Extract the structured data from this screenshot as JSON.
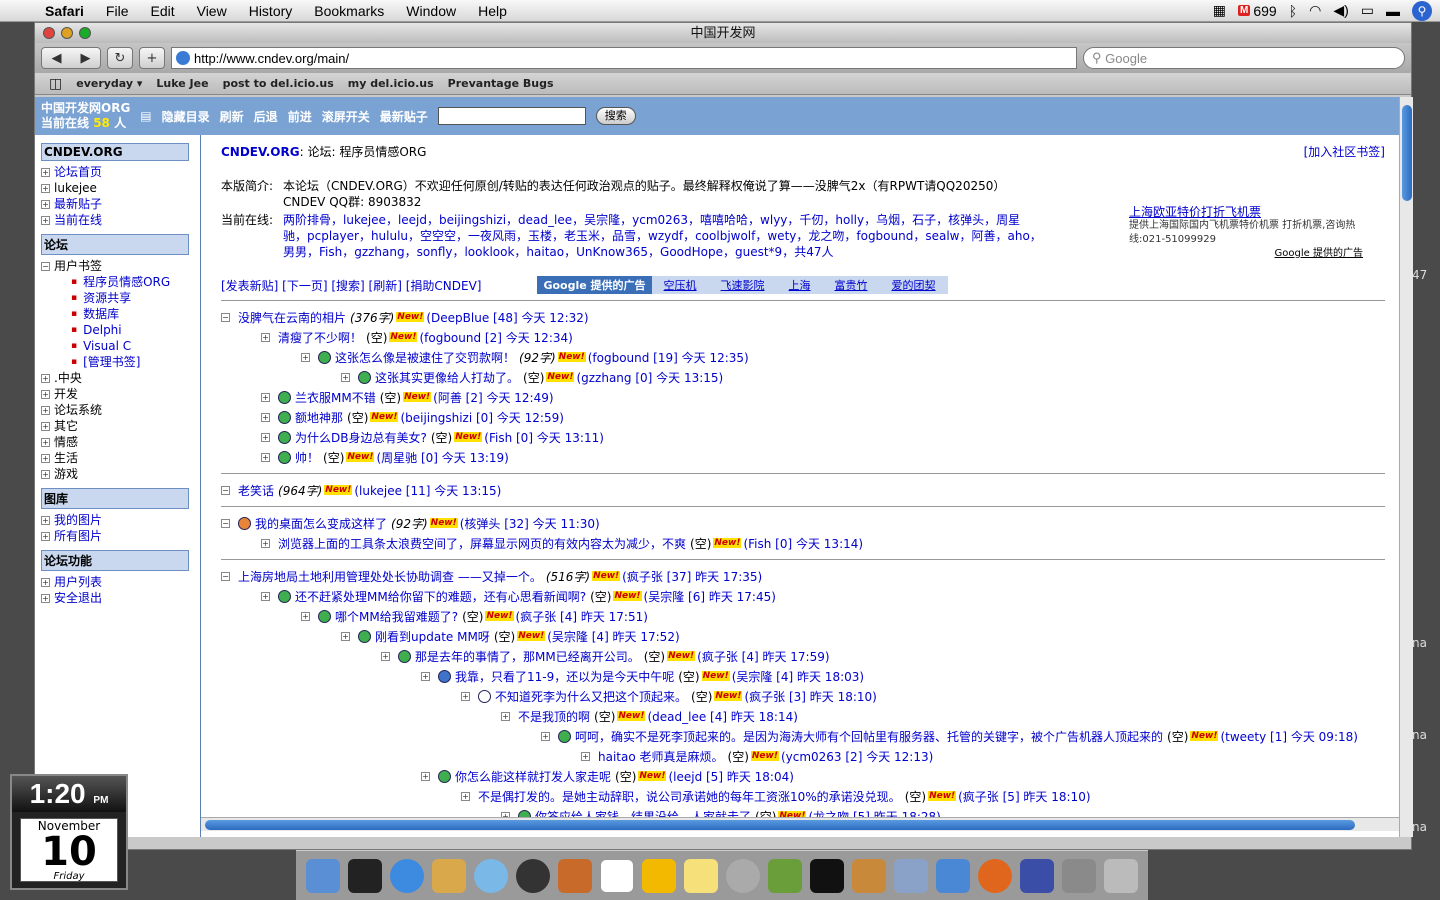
{
  "menubar": {
    "app": "Safari",
    "items": [
      "File",
      "Edit",
      "View",
      "History",
      "Bookmarks",
      "Window",
      "Help"
    ],
    "mail_count": "699"
  },
  "window": {
    "title": "中国开发网"
  },
  "toolbar": {
    "url": "http://www.cndev.org/main/",
    "search_placeholder": "Google"
  },
  "bookmarks": [
    "everyday ▾",
    "Luke Jee",
    "post to del.icio.us",
    "my del.icio.us",
    "Prevantage Bugs"
  ],
  "topbar": {
    "site": "中国开发网ORG",
    "online_prefix": "当前在线",
    "online_count": "58",
    "online_suffix": "人",
    "links": [
      "隐藏目录",
      "刷新",
      "后退",
      "前进",
      "滚屏开关",
      "最新贴子"
    ],
    "search_button": "搜索"
  },
  "sidebar": {
    "title": "CNDEV.ORG",
    "group1": [
      "论坛首页",
      "lukejee",
      "最新贴子",
      "当前在线"
    ],
    "section_forum": "论坛",
    "bookmarks_label": "用户书签",
    "bookmark_items": [
      "程序员情感ORG",
      "资源共享",
      "数据库",
      "Delphi",
      "Visual C",
      "[管理书签]"
    ],
    "forum_items": [
      ".中央",
      "开发",
      "论坛系统",
      "其它",
      "情感",
      "生活",
      "游戏"
    ],
    "section_photos": "图库",
    "photo_items": [
      "我的图片",
      "所有图片"
    ],
    "section_functions": "论坛功能",
    "function_items": [
      "用户列表",
      "安全退出"
    ]
  },
  "main": {
    "brand": "CNDEV.ORG",
    "crumb": ": 论坛: 程序员情感ORG",
    "join_link": "[加入社区书签]",
    "intro_label": "本版简介:",
    "intro_text": "本论坛（CNDEV.ORG）不欢迎任何原创/转贴的表达任何政治观点的贴子。最终解释权俺说了算——没脾气2x（有RPWT请QQ20250）",
    "qq_group": "CNDEV QQ群: 8903832",
    "online_label": "当前在线:",
    "online_users": "两阶排骨，lukejee，leejd，beijingshizi，dead_lee，吴宗隆，ycm0263，嘻嘻哈哈，wlyy，千仞，holly，乌烟，石子，核弹头，周星驰，pcplayer，hululu，空空空，一夜风雨，玉楼，老玉米，品雪，wzydf，coolbjwolf，wety，龙之吻，fogbound，sealw，阿善，aho，男男，Fish，gzzhang，sonfly，looklook，haitao，UnKnow365，GoodHope，guest*9，共47人",
    "actions": "[发表新贴] [下一页] [搜索] [刷新] [捐助CNDEV]",
    "google_ads_label": "Google 提供的广告",
    "google_ads": [
      "空压机",
      "飞速影院",
      "上海",
      "富贵竹",
      "爱的团契"
    ],
    "ad_title": "上海欧亚特价打折飞机票",
    "ad_body": "提供上海国际国内飞机票特价机票 打折机票,咨询热线:021-51099929",
    "ad_google": "Google 提供的广告",
    "new_badge": "New!",
    "threads": [
      {
        "indent": 0,
        "icon": "none",
        "title": "没脾气在云南的相片",
        "meta": "(376字)",
        "tail": "(DeepBlue [48] 今天 12:32)"
      },
      {
        "indent": 1,
        "icon": "none",
        "title": "清瘦了不少啊！",
        "meta": "(空)",
        "tail": "(fogbound [2] 今天 12:34)"
      },
      {
        "indent": 2,
        "icon": "g",
        "title": "这张怎么像是被逮住了交罚款啊！",
        "meta": "(92字)",
        "tail": "(fogbound [19] 今天 12:35)"
      },
      {
        "indent": 3,
        "icon": "g",
        "title": "这张其实更像给人打劫了。",
        "meta": "(空)",
        "tail": "(gzzhang [0] 今天 13:15)"
      },
      {
        "indent": 1,
        "icon": "g",
        "title": "兰衣服MM不错",
        "meta": "(空)",
        "tail": "(阿善 [2] 今天 12:49)"
      },
      {
        "indent": 1,
        "icon": "g",
        "title": "额地神那",
        "meta": "(空)",
        "tail": "(beijingshizi [0] 今天 12:59)"
      },
      {
        "indent": 1,
        "icon": "g",
        "title": "为什么DB身边总有美女?",
        "meta": "(空)",
        "tail": "(Fish [0] 今天 13:11)"
      },
      {
        "indent": 1,
        "icon": "g",
        "title": "帅！",
        "meta": "(空)",
        "tail": "(周星驰 [0] 今天 13:19)"
      },
      {
        "indent": 0,
        "icon": "none",
        "title": "老笑话",
        "meta": "(964字)",
        "tail": "(lukejee [11] 今天 13:15)",
        "sep": true
      },
      {
        "indent": 0,
        "icon": "o",
        "title": "我的桌面怎么变成这样了",
        "meta": "(92字)",
        "tail": "(核弹头 [32] 今天 11:30)",
        "sep": true
      },
      {
        "indent": 1,
        "icon": "none",
        "title": "浏览器上面的工具条太浪费空间了，屏幕显示网页的有效内容太为减少，不爽",
        "meta": "(空)",
        "tail": "(Fish [0] 今天 13:14)"
      },
      {
        "indent": 0,
        "icon": "none",
        "title": "上海房地局土地利用管理处处长协助调查 ——又掉一个。",
        "meta": "(516字)",
        "tail": "(疯子张 [37] 昨天 17:35)",
        "sep": true
      },
      {
        "indent": 1,
        "icon": "g",
        "title": "还不赶紧处理MM给你留下的难题，还有心思看新闻啊?",
        "meta": "(空)",
        "tail": "(吴宗隆 [6] 昨天 17:45)"
      },
      {
        "indent": 2,
        "icon": "g",
        "title": "哪个MM给我留难题了?",
        "meta": "(空)",
        "tail": "(疯子张 [4] 昨天 17:51)"
      },
      {
        "indent": 3,
        "icon": "g",
        "title": "刚看到update MM呀",
        "meta": "(空)",
        "tail": "(吴宗隆 [4] 昨天 17:52)"
      },
      {
        "indent": 4,
        "icon": "g",
        "title": "那是去年的事情了，那MM已经离开公司。",
        "meta": "(空)",
        "tail": "(疯子张 [4] 昨天 17:59)"
      },
      {
        "indent": 5,
        "icon": "b",
        "title": "我靠，只看了11-9，还以为是今天中午呢",
        "meta": "(空)",
        "tail": "(吴宗隆 [4] 昨天 18:03)"
      },
      {
        "indent": 6,
        "icon": "w",
        "title": "不知道死李为什么又把这个顶起来。",
        "meta": "(空)",
        "tail": "(疯子张 [3] 昨天 18:10)"
      },
      {
        "indent": 7,
        "icon": "none",
        "title": "不是我顶的啊",
        "meta": "(空)",
        "tail": "(dead_lee [4] 昨天 18:14)"
      },
      {
        "indent": 8,
        "icon": "g",
        "title": "呵呵，确实不是死李顶起来的。是因为海涛大师有个回帖里有服务器、托管的关键字，被个广告机器人顶起来的",
        "meta": "(空)",
        "tail": "(tweety [1] 今天 09:18)"
      },
      {
        "indent": 9,
        "icon": "none",
        "title": "haitao 老师真是麻烦。",
        "meta": "(空)",
        "tail": "(ycm0263 [2] 今天 12:13)"
      },
      {
        "indent": 5,
        "icon": "g",
        "title": "你怎么能这样就打发人家走呢",
        "meta": "(空)",
        "tail": "(leejd [5] 昨天 18:04)"
      },
      {
        "indent": 6,
        "icon": "none",
        "title": "不是偶打发的。是她主动辞职，说公司承诺她的每年工资涨10%的承诺没兑现。",
        "meta": "(空)",
        "tail": "(疯子张 [5] 昨天 18:10)"
      },
      {
        "indent": 7,
        "icon": "g",
        "title": "你答应给人家钱，结果没给，人家就走了",
        "meta": "(空)",
        "tail": "(龙之吻 [5] 昨天 18:28)"
      }
    ]
  },
  "clock": {
    "time": "1:20",
    "ampm": "PM",
    "month": "November",
    "day": "10",
    "weekday": "Friday"
  },
  "edge_texts": [
    "47",
    "na",
    "na",
    "na"
  ],
  "colors": {
    "topbar": "#7aa3d4",
    "link": "#0000cc",
    "section": "#c9d8ef"
  }
}
